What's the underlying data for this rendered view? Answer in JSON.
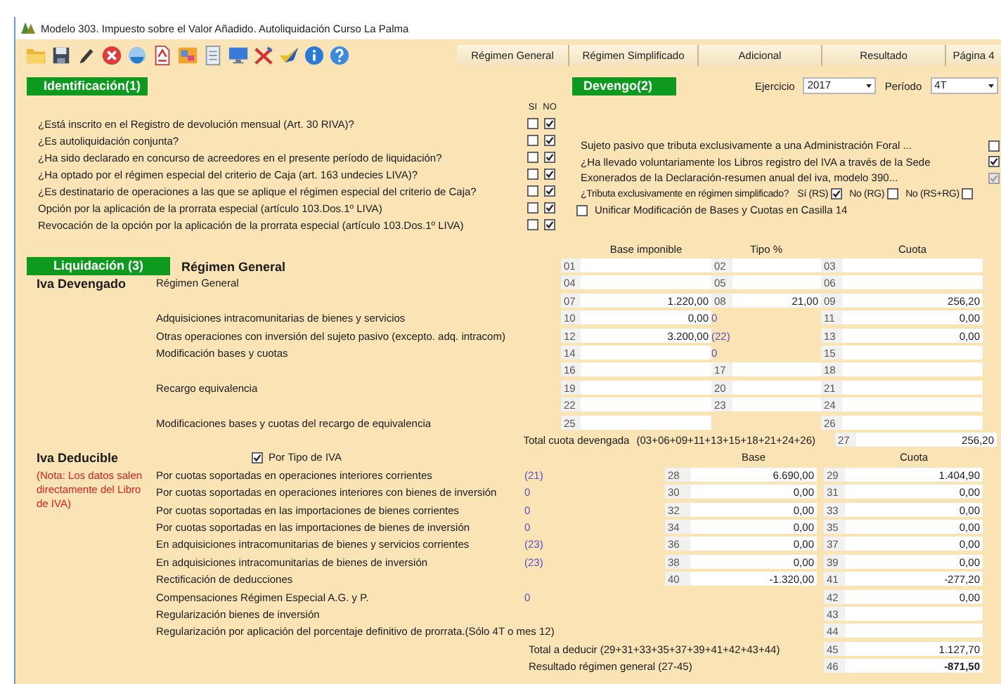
{
  "window": {
    "title": "Modelo 303. Impuesto sobre el Valor Añadido. Autoliquidación Curso La Palma"
  },
  "tabs": [
    {
      "label": "Régimen General",
      "selected": false
    },
    {
      "label": "Régimen Simplificado",
      "selected": false
    },
    {
      "label": "Adicional",
      "selected": false
    },
    {
      "label": "Resultado",
      "selected": false
    },
    {
      "label": "Página 4",
      "selected": false
    }
  ],
  "identificacion": {
    "title": "Identificación(1)",
    "si_label": "SI",
    "no_label": "NO",
    "questions": [
      {
        "text": "¿Está inscrito en el Registro de devolución mensual (Art. 30 RIVA)?",
        "si": false,
        "no": true
      },
      {
        "text": "¿Es autoliquidación conjunta?",
        "si": false,
        "no": true
      },
      {
        "text": "¿Ha sido declarado en concurso de acreedores en el presente período de liquidación?",
        "si": false,
        "no": true
      },
      {
        "text": "¿Ha optado por el régimen especial del criterio de Caja (art. 163 undecies LIVA)?",
        "si": false,
        "no": true
      },
      {
        "text": "¿Es destinatario de operaciones a las que se aplique el régimen especial del criterio de Caja?",
        "si": false,
        "no": true
      },
      {
        "text": "Opción por la aplicación de la prorrata especial (artículo 103.Dos.1º LIVA)",
        "si": false,
        "no": true
      },
      {
        "text": "Revocación de la opción por la aplicación de la prorrata especial (artículo 103.Dos.1º LIVA)",
        "si": false,
        "no": true
      }
    ]
  },
  "devengo": {
    "title": "Devengo(2)",
    "ejercicio": {
      "label": "Ejercicio",
      "value": "2017"
    },
    "periodo": {
      "label": "Período",
      "value": "4T"
    },
    "options": [
      {
        "text": "Sujeto pasivo que tributa exclusivamente a una Administración Foral ...",
        "checked": false,
        "disabled": false
      },
      {
        "text": "¿Ha llevado voluntariamente los Libros registro del IVA a través de la Sede",
        "checked": true,
        "disabled": false
      },
      {
        "text": "Exonerados de la Declaración-resumen anual del iva, modelo 390...",
        "checked": true,
        "disabled": true
      }
    ],
    "tributa": {
      "text": "¿Tributa exclusivamente en régimen simplificado?",
      "choices": [
        {
          "label": "Sí (RS)",
          "checked": true
        },
        {
          "label": "No (RG)",
          "checked": false
        },
        {
          "label": "No (RS+RG)",
          "checked": false
        }
      ]
    },
    "unificar": {
      "text": "Unificar Modificación de Bases y Cuotas en Casilla 14",
      "checked": false
    }
  },
  "liquidacion": {
    "title": "Liquidación (3)",
    "subtitle": "Régimen General",
    "devengado": {
      "title": "Iva Devengado",
      "headers": [
        "Base imponible",
        "Tipo %",
        "Cuota"
      ],
      "rows": [
        {
          "base": {
            "code": "01"
          },
          "tipo": {
            "code": "02"
          },
          "cuota": {
            "code": "03"
          }
        },
        {
          "label": "Régimen General",
          "base": {
            "code": "04"
          },
          "tipo": {
            "code": "05"
          },
          "cuota": {
            "code": "06"
          }
        },
        {
          "base": {
            "code": "07",
            "value": "1.220,00"
          },
          "tipo": {
            "code": "08",
            "value": "21,00"
          },
          "cuota": {
            "code": "09",
            "value": "256,20"
          }
        },
        {
          "label": "Adquisiciones intracomunitarias de bienes y servicios",
          "base": {
            "code": "10",
            "value": "0,00"
          },
          "tipo_ref": "0",
          "cuota": {
            "code": "11",
            "value": "0,00"
          }
        },
        {
          "label": "Otras operaciones con inversión del sujeto pasivo (excepto. adq. intracom)",
          "base": {
            "code": "12",
            "value": "3.200,00"
          },
          "tipo_ref": "(22)",
          "cuota": {
            "code": "13",
            "value": "0,00"
          }
        },
        {
          "label": "Modificación bases y cuotas",
          "base": {
            "code": "14"
          },
          "tipo_ref": "0",
          "cuota": {
            "code": "15"
          }
        },
        {
          "base": {
            "code": "16"
          },
          "tipo": {
            "code": "17"
          },
          "cuota": {
            "code": "18"
          }
        },
        {
          "label": "Recargo equivalencia",
          "base": {
            "code": "19"
          },
          "tipo": {
            "code": "20"
          },
          "cuota": {
            "code": "21"
          }
        },
        {
          "base": {
            "code": "22"
          },
          "tipo": {
            "code": "23"
          },
          "cuota": {
            "code": "24"
          }
        },
        {
          "label": "Modificaciones bases y cuotas del recargo de equivalencia",
          "base": {
            "code": "25"
          },
          "cuota": {
            "code": "26"
          }
        }
      ],
      "total": {
        "label": "Total cuota devengada",
        "formula": "(03+06+09+11+13+15+18+21+24+26)",
        "cuota": {
          "code": "27",
          "value": "256,20"
        }
      }
    },
    "deducible": {
      "title": "Iva Deducible",
      "note": "(Nota: Los datos salen directamente del Libro de IVA)",
      "por_tipo": {
        "label": "Por Tipo de IVA",
        "checked": true
      },
      "headers": [
        "Base",
        "Cuota"
      ],
      "rows": [
        {
          "label": "Por cuotas soportadas en operaciones interiores corrientes",
          "ref": "(21)",
          "base": {
            "code": "28",
            "value": "6.690,00"
          },
          "cuota": {
            "code": "29",
            "value": "1.404,90"
          }
        },
        {
          "label": "Por cuotas soportadas en operaciones interiores con bienes de inversión",
          "ref": "0",
          "base": {
            "code": "30",
            "value": "0,00"
          },
          "cuota": {
            "code": "31",
            "value": "0,00"
          }
        },
        {
          "label": "Por cuotas soportadas en las importaciones de bienes corrientes",
          "ref": "0",
          "base": {
            "code": "32",
            "value": "0,00"
          },
          "cuota": {
            "code": "33",
            "value": "0,00"
          }
        },
        {
          "label": "Por cuotas soportadas en las importaciones de bienes de inversión",
          "ref": "0",
          "base": {
            "code": "34",
            "value": "0,00"
          },
          "cuota": {
            "code": "35",
            "value": "0,00"
          }
        },
        {
          "label": "En adquisiciones intracomunitarias de bienes y servicios corrientes",
          "ref": "(23)",
          "base": {
            "code": "36",
            "value": "0,00"
          },
          "cuota": {
            "code": "37",
            "value": "0,00"
          }
        },
        {
          "label": "En adquisiciones intracomunitarias de bienes de inversión",
          "ref": "(23)",
          "base": {
            "code": "38",
            "value": "0,00"
          },
          "cuota": {
            "code": "39",
            "value": "0,00"
          }
        },
        {
          "label": "Rectificación de deducciones",
          "base": {
            "code": "40",
            "value": "-1.320,00"
          },
          "cuota": {
            "code": "41",
            "value": "-277,20"
          }
        },
        {
          "label": "Compensaciones Régimen Especial A.G. y P.",
          "ref": "0",
          "cuota": {
            "code": "42",
            "value": "0,00"
          }
        },
        {
          "label": "Regularización bienes de inversión",
          "cuota": {
            "code": "43"
          }
        },
        {
          "label": "Regularización por aplicación del porcentaje definitivo de prorrata.(Sólo 4T o mes 12)",
          "cuota": {
            "code": "44"
          }
        },
        {
          "kind": "total",
          "label": "Total a deducir (29+31+33+35+37+39+41+42+43+44)",
          "cuota": {
            "code": "45",
            "value": "1.127,70"
          }
        },
        {
          "kind": "total",
          "label": "Resultado régimen general (27-45)",
          "emphasis": true,
          "cuota": {
            "code": "46",
            "value": "-871,50"
          }
        }
      ]
    }
  }
}
